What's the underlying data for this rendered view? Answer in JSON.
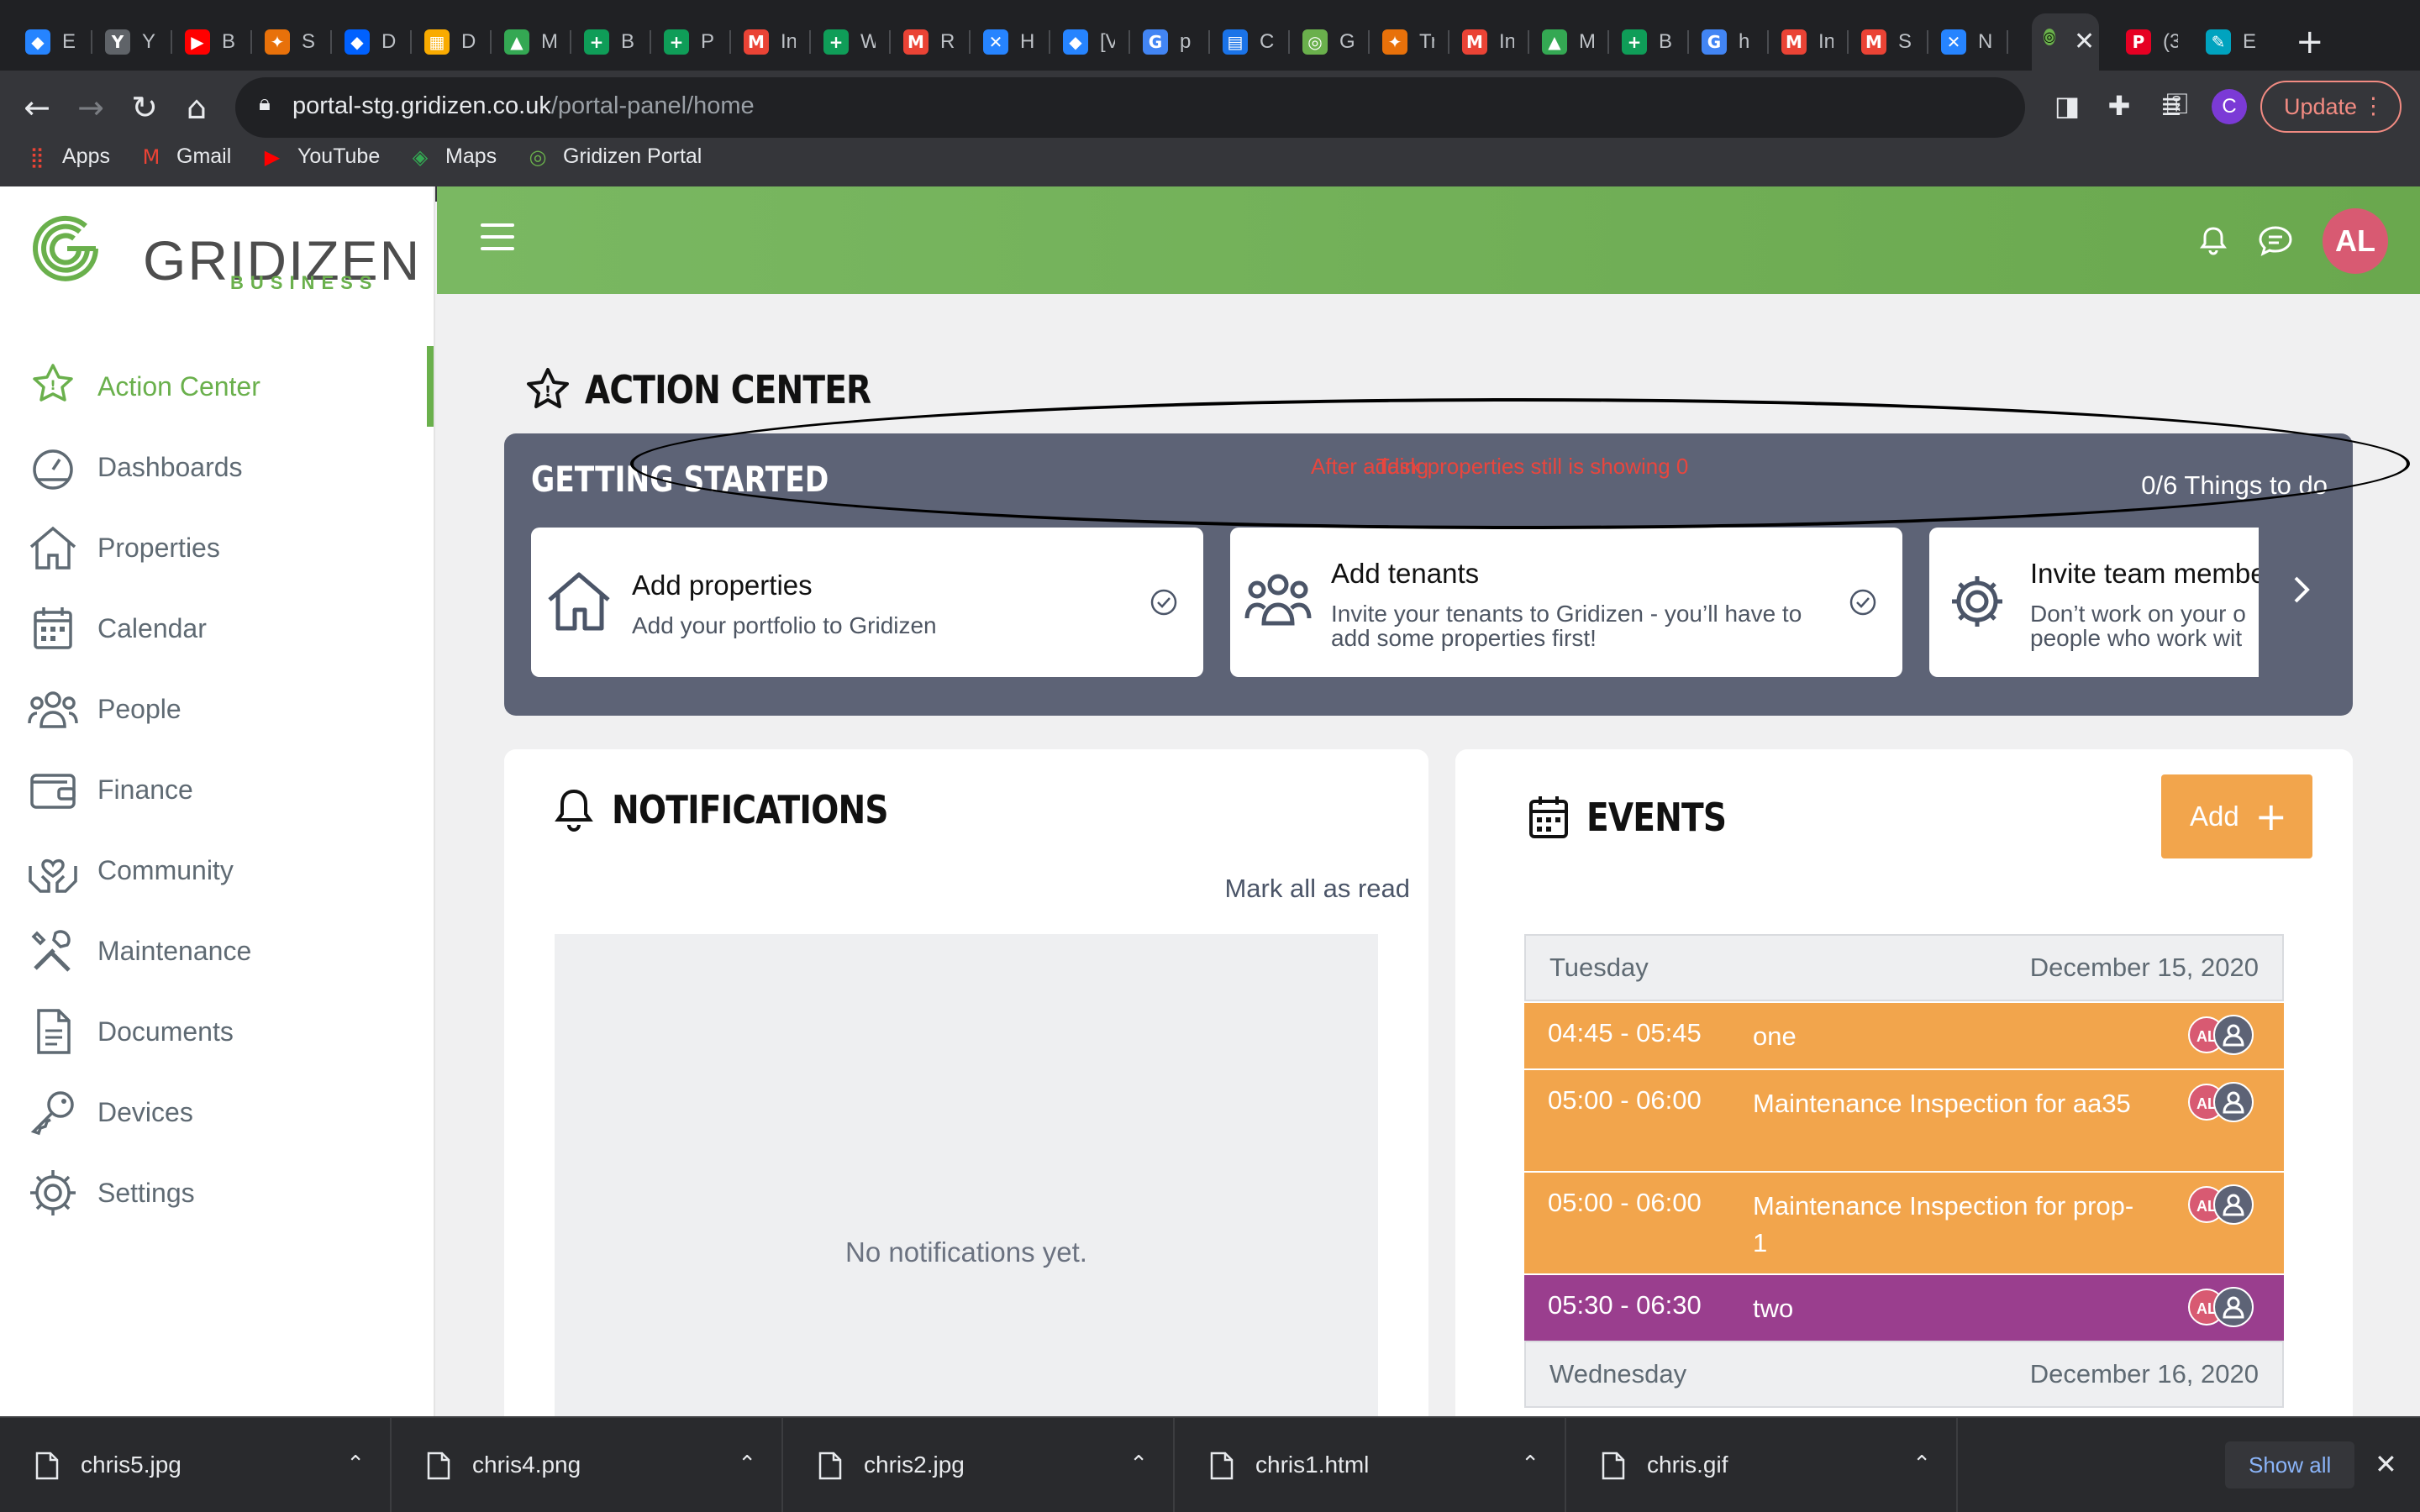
{
  "browser": {
    "tabs": [
      {
        "icon": "jira-icon",
        "color": "#2684ff",
        "glyph": "◆",
        "label": "E"
      },
      {
        "icon": "yammer-icon",
        "color": "#5f6368",
        "glyph": "Y",
        "label": "Y"
      },
      {
        "icon": "youtube-icon",
        "color": "#ff0000",
        "glyph": "▶",
        "label": "B"
      },
      {
        "icon": "puzzle-icon",
        "color": "#e8710a",
        "glyph": "✦",
        "label": "S"
      },
      {
        "icon": "dropbox-icon",
        "color": "#0061ff",
        "glyph": "◆",
        "label": "D"
      },
      {
        "icon": "calendar-app-icon",
        "color": "#f9ab00",
        "glyph": "▦",
        "label": "D"
      },
      {
        "icon": "drive-icon",
        "color": "#34a853",
        "glyph": "▲",
        "label": "M"
      },
      {
        "icon": "sheets-icon",
        "color": "#0f9d58",
        "glyph": "+",
        "label": "B"
      },
      {
        "icon": "sheets-icon",
        "color": "#0f9d58",
        "glyph": "+",
        "label": "P"
      },
      {
        "icon": "gmail-icon",
        "color": "#ea4335",
        "glyph": "M",
        "label": "In"
      },
      {
        "icon": "sheets-icon",
        "color": "#0f9d58",
        "glyph": "+",
        "label": "W"
      },
      {
        "icon": "gmail-icon",
        "color": "#ea4335",
        "glyph": "M",
        "label": "R"
      },
      {
        "icon": "confluence-icon",
        "color": "#2684ff",
        "glyph": "✕",
        "label": "H"
      },
      {
        "icon": "jira-icon",
        "color": "#2684ff",
        "glyph": "◆",
        "label": "[V"
      },
      {
        "icon": "google-icon",
        "color": "#4285f4",
        "glyph": "G",
        "label": "p"
      },
      {
        "icon": "doc-app-icon",
        "color": "#1a73e8",
        "glyph": "▤",
        "label": "C"
      },
      {
        "icon": "gridizen-icon",
        "color": "#6ab04c",
        "glyph": "◎",
        "label": "G"
      },
      {
        "icon": "puzzle-icon",
        "color": "#e8710a",
        "glyph": "✦",
        "label": "Tr"
      },
      {
        "icon": "gmail-icon",
        "color": "#ea4335",
        "glyph": "M",
        "label": "In"
      },
      {
        "icon": "drive-icon",
        "color": "#34a853",
        "glyph": "▲",
        "label": "M"
      },
      {
        "icon": "sheets-icon",
        "color": "#0f9d58",
        "glyph": "+",
        "label": "B"
      },
      {
        "icon": "google-icon",
        "color": "#4285f4",
        "glyph": "G",
        "label": "h"
      },
      {
        "icon": "gmail-icon",
        "color": "#ea4335",
        "glyph": "M",
        "label": "In"
      },
      {
        "icon": "gmail-icon",
        "color": "#ea4335",
        "glyph": "M",
        "label": "S"
      },
      {
        "icon": "confluence-icon",
        "color": "#2684ff",
        "glyph": "✕",
        "label": "N"
      }
    ],
    "active_tab": {
      "icon": "gridizen-icon",
      "close": "✕"
    },
    "after_tabs": [
      {
        "icon": "pinterest-icon",
        "color": "#e60023",
        "glyph": "P",
        "label": "(3"
      },
      {
        "icon": "edit-app-icon",
        "color": "#00a3bf",
        "glyph": "✎",
        "label": "E"
      }
    ],
    "new_tab": "+",
    "url_host": "portal-stg.gridizen.co.uk",
    "url_path": "/portal-panel/home",
    "update_label": "Update",
    "profile_initial": "C",
    "bookmarks": [
      {
        "icon": "apps-grid-icon",
        "color": "#ea4335",
        "glyph": "⣿",
        "label": "Apps"
      },
      {
        "icon": "gmail-icon",
        "color": "#ea4335",
        "glyph": "M",
        "label": "Gmail"
      },
      {
        "icon": "youtube-icon",
        "color": "#ff0000",
        "glyph": "▶",
        "label": "YouTube"
      },
      {
        "icon": "maps-icon",
        "color": "#34a853",
        "glyph": "◈",
        "label": "Maps"
      },
      {
        "icon": "gridizen-icon",
        "color": "#6ab04c",
        "glyph": "◎",
        "label": "Gridizen Portal"
      }
    ]
  },
  "logo": {
    "word": "GRIDIZEN",
    "sub": "BUSINESS"
  },
  "sidebar": {
    "items": [
      {
        "label": "Action Center",
        "icon": "action-center-icon",
        "active": true
      },
      {
        "label": "Dashboards",
        "icon": "dashboard-gauge-icon"
      },
      {
        "label": "Properties",
        "icon": "house-icon"
      },
      {
        "label": "Calendar",
        "icon": "calendar-icon"
      },
      {
        "label": "People",
        "icon": "people-icon"
      },
      {
        "label": "Finance",
        "icon": "wallet-icon"
      },
      {
        "label": "Community",
        "icon": "community-hands-icon"
      },
      {
        "label": "Maintenance",
        "icon": "tools-icon"
      },
      {
        "label": "Documents",
        "icon": "document-icon"
      },
      {
        "label": "Devices",
        "icon": "key-icon"
      },
      {
        "label": "Settings",
        "icon": "gear-icon"
      }
    ]
  },
  "header": {
    "avatar_initials": "AL"
  },
  "action_center": {
    "title": "ACTION CENTER",
    "getting_started": {
      "title": "GETTING STARTED",
      "count": "0/6 Things to do",
      "cards": [
        {
          "title": "Add properties",
          "desc": "Add your portfolio to Gridizen"
        },
        {
          "title": "Add tenants",
          "desc": "Invite your tenants to Gridizen - you’ll have to add some properties first!"
        },
        {
          "title": "Invite team membe",
          "desc": "Don’t work on your o people who work wit"
        }
      ]
    },
    "annotation": {
      "text_a": "After adding",
      "text_b": "Task properties still is showing 0"
    }
  },
  "notifications": {
    "title": "NOTIFICATIONS",
    "mark_all": "Mark all as read",
    "empty": "No notifications yet."
  },
  "events": {
    "title": "EVENTS",
    "add_label": "Add",
    "days": [
      {
        "day": "Tuesday",
        "date": "December 15, 2020",
        "items": [
          {
            "time": "04:45 - 05:45",
            "title": "one",
            "color": "#f2a54c",
            "avatar": "AL"
          },
          {
            "time": "05:00 - 06:00",
            "title": "Maintenance Inspection for aa35",
            "color": "#f2a54c",
            "avatar": "AL"
          },
          {
            "time": "05:00 - 06:00",
            "title": "Maintenance Inspection for prop-1",
            "color": "#f2a54c",
            "avatar": "AL"
          },
          {
            "time": "05:30 - 06:30",
            "title": "two",
            "color": "#9a3e8e",
            "avatar": "AL"
          }
        ]
      },
      {
        "day": "Wednesday",
        "date": "December 16, 2020",
        "items": []
      }
    ]
  },
  "downloads": {
    "files": [
      "chris5.jpg",
      "chris4.png",
      "chris2.jpg",
      "chris1.html",
      "chris.gif"
    ],
    "show_all": "Show all"
  }
}
